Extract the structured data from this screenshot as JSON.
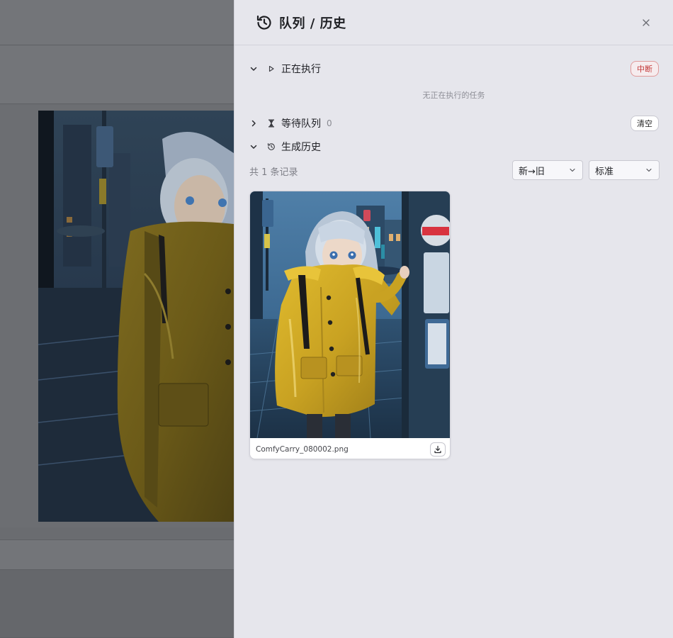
{
  "drawer": {
    "title": "队列 / 历史",
    "close_label": "×"
  },
  "running": {
    "label": "正在执行",
    "interrupt_label": "中断",
    "empty_text": "无正在执行的任务"
  },
  "queue": {
    "label": "等待队列",
    "count": "0",
    "clear_label": "清空"
  },
  "history": {
    "label": "生成历史",
    "record_count": "共 1 条记录",
    "sort_selected": "新→旧",
    "size_selected": "标准",
    "items": [
      {
        "filename": "ComfyCarry_080002.png"
      }
    ]
  },
  "colors": {
    "drawer_bg": "#e6e6ec",
    "interrupt": "#c33a3a",
    "raincoat": "#d4b024",
    "night_blue": "#2e4a66"
  },
  "icons": [
    "history-icon",
    "close-icon",
    "chevron-down-icon",
    "chevron-right-icon",
    "play-icon",
    "hourglass-icon",
    "download-icon"
  ]
}
